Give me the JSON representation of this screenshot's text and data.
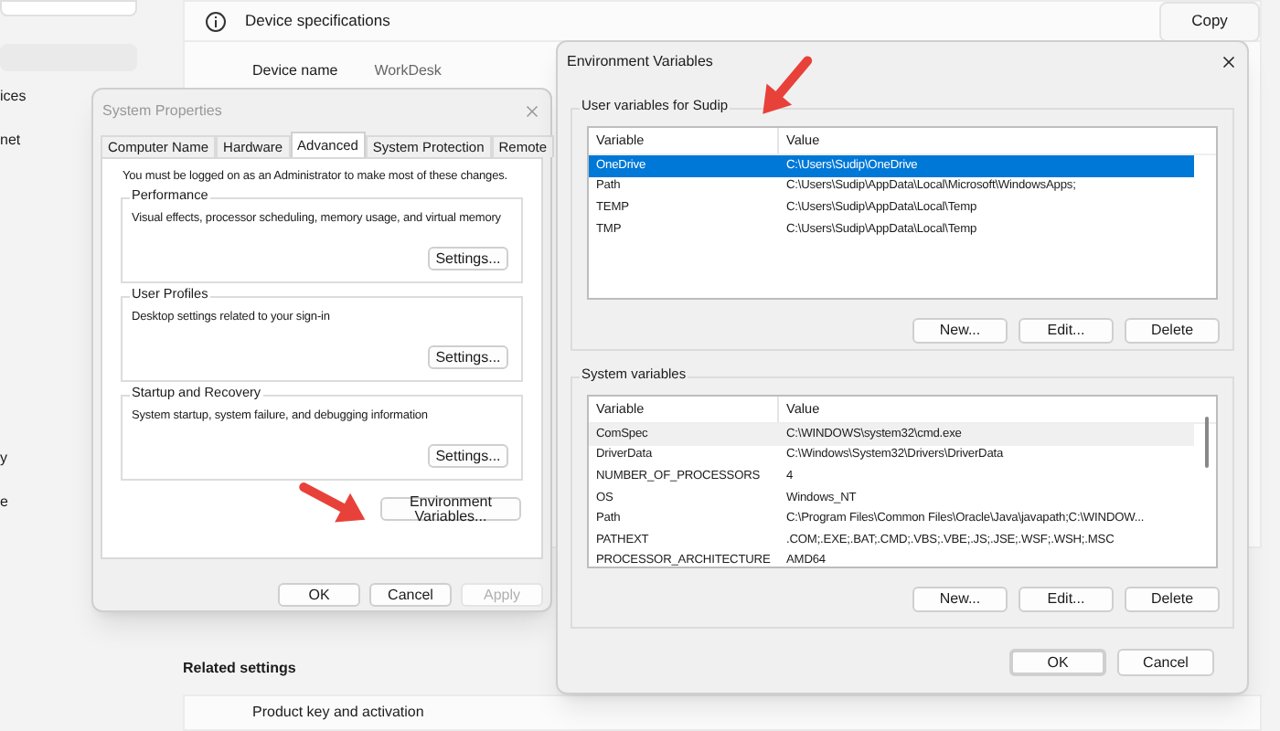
{
  "settings": {
    "sidebar": {
      "items": [
        {
          "label": "ices"
        },
        {
          "label": "net"
        },
        {
          "label": "y"
        },
        {
          "label": "e"
        }
      ]
    },
    "device_specifications": {
      "title": "Device specifications",
      "copy_button": "Copy",
      "device_name_label": "Device name",
      "device_name_value": "WorkDesk"
    },
    "related_settings": {
      "title": "Related settings",
      "items": [
        "Product key and activation"
      ]
    }
  },
  "system_properties": {
    "title": "System Properties",
    "tabs": [
      {
        "label": "Computer Name",
        "selected": false
      },
      {
        "label": "Hardware",
        "selected": false
      },
      {
        "label": "Advanced",
        "selected": true
      },
      {
        "label": "System Protection",
        "selected": false
      },
      {
        "label": "Remote",
        "selected": false
      }
    ],
    "notice": "You must be logged on as an Administrator to make most of these changes.",
    "groups": [
      {
        "title": "Performance",
        "description": "Visual effects, processor scheduling, memory usage, and virtual memory",
        "button": "Settings..."
      },
      {
        "title": "User Profiles",
        "description": "Desktop settings related to your sign-in",
        "button": "Settings..."
      },
      {
        "title": "Startup and Recovery",
        "description": "System startup, system failure, and debugging information",
        "button": "Settings..."
      }
    ],
    "environment_button": "Environment Variables...",
    "buttons": [
      {
        "label": "OK",
        "disabled": false
      },
      {
        "label": "Cancel",
        "disabled": false
      },
      {
        "label": "Apply",
        "disabled": true
      }
    ]
  },
  "environment_variables": {
    "title": "Environment Variables",
    "sections": [
      {
        "title": "User variables for Sudip",
        "columns": [
          "Variable",
          "Value"
        ],
        "scrollbar": false,
        "rows": [
          {
            "variable": "OneDrive",
            "value": "C:\\Users\\Sudip\\OneDrive",
            "selected": true
          },
          {
            "variable": "Path",
            "value": "C:\\Users\\Sudip\\AppData\\Local\\Microsoft\\WindowsApps;",
            "selected": false
          },
          {
            "variable": "TEMP",
            "value": "C:\\Users\\Sudip\\AppData\\Local\\Temp",
            "selected": false
          },
          {
            "variable": "TMP",
            "value": "C:\\Users\\Sudip\\AppData\\Local\\Temp",
            "selected": false
          }
        ],
        "buttons": [
          "New...",
          "Edit...",
          "Delete"
        ]
      },
      {
        "title": "System variables",
        "columns": [
          "Variable",
          "Value"
        ],
        "scrollbar": true,
        "rows": [
          {
            "variable": "ComSpec",
            "value": "C:\\WINDOWS\\system32\\cmd.exe",
            "selected": false
          },
          {
            "variable": "DriverData",
            "value": "C:\\Windows\\System32\\Drivers\\DriverData",
            "selected": false
          },
          {
            "variable": "NUMBER_OF_PROCESSORS",
            "value": "4",
            "selected": false
          },
          {
            "variable": "OS",
            "value": "Windows_NT",
            "selected": false
          },
          {
            "variable": "Path",
            "value": "C:\\Program Files\\Common Files\\Oracle\\Java\\javapath;C:\\WINDOW...",
            "selected": false
          },
          {
            "variable": "PATHEXT",
            "value": ".COM;.EXE;.BAT;.CMD;.VBS;.VBE;.JS;.JSE;.WSF;.WSH;.MSC",
            "selected": false
          },
          {
            "variable": "PROCESSOR_ARCHITECTURE",
            "value": "AMD64",
            "selected": false
          }
        ],
        "buttons": [
          "New...",
          "Edit...",
          "Delete"
        ]
      }
    ],
    "buttons": [
      {
        "label": "OK",
        "default": true
      },
      {
        "label": "Cancel",
        "default": false
      }
    ]
  }
}
